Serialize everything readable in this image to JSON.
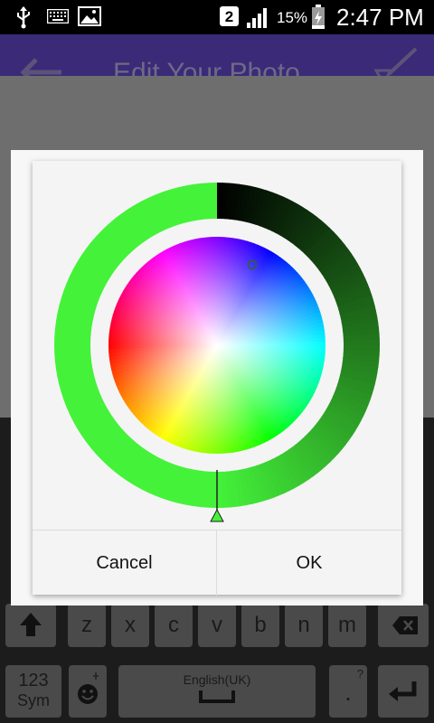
{
  "status_bar": {
    "sim_badge": "2",
    "battery_percent": "15%",
    "time": "2:47 PM",
    "icons": [
      "usb-icon",
      "keyboard-icon",
      "image-icon",
      "signal-icon",
      "battery-icon"
    ]
  },
  "app_bar": {
    "title": "Edit Your Photo",
    "icons": [
      "back-arrow-icon",
      "brush-save-icon"
    ]
  },
  "color_picker": {
    "selected_color": "#44f23a",
    "value_ring_start": "#44f23a",
    "value_ring_end": "#000000",
    "value_level": 1.0
  },
  "dialog": {
    "cancel_label": "Cancel",
    "ok_label": "OK"
  },
  "keyboard": {
    "row3": [
      "z",
      "x",
      "c",
      "v",
      "b",
      "n",
      "m"
    ],
    "sym_label": "123",
    "sym_label2": "Sym",
    "space_label": "English(UK)",
    "period_label": ".",
    "period_hint": "?"
  }
}
